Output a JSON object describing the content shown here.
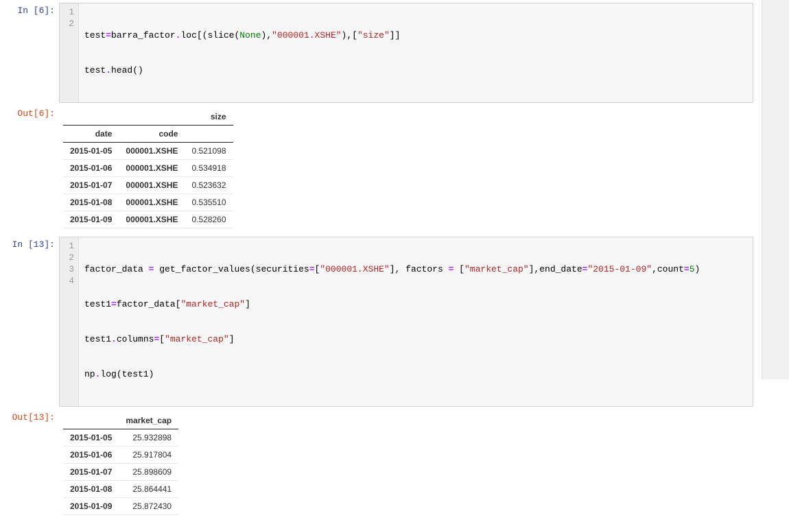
{
  "cells": [
    {
      "in_prompt": "In [6]:",
      "out_prompt": "Out[6]:",
      "code_lines": [
        {
          "n": "1",
          "text": "test=barra_factor.loc[(slice(None),\"000001.XSHE\"),[\"size\"]]"
        },
        {
          "n": "2",
          "text": "test.head()"
        }
      ],
      "table": {
        "col_header": "size",
        "idx_headers": [
          "date",
          "code"
        ],
        "rows": [
          {
            "date": "2015-01-05",
            "code": "000001.XSHE",
            "val": "0.521098"
          },
          {
            "date": "2015-01-06",
            "code": "000001.XSHE",
            "val": "0.534918"
          },
          {
            "date": "2015-01-07",
            "code": "000001.XSHE",
            "val": "0.523632"
          },
          {
            "date": "2015-01-08",
            "code": "000001.XSHE",
            "val": "0.535510"
          },
          {
            "date": "2015-01-09",
            "code": "000001.XSHE",
            "val": "0.528260"
          }
        ]
      }
    },
    {
      "in_prompt": "In [13]:",
      "out_prompt": "Out[13]:",
      "code_lines": [
        {
          "n": "1",
          "text": "factor_data = get_factor_values(securities=[\"000001.XSHE\"], factors = [\"market_cap\"],end_date=\"2015-01-09\",count=5)"
        },
        {
          "n": "2",
          "text": "test1=factor_data[\"market_cap\"]"
        },
        {
          "n": "3",
          "text": "test1.columns=[\"market_cap\"]"
        },
        {
          "n": "4",
          "text": "np.log(test1)"
        }
      ],
      "table": {
        "col_header": "market_cap",
        "idx_headers": [],
        "rows": [
          {
            "date": "2015-01-05",
            "val": "25.932898"
          },
          {
            "date": "2015-01-06",
            "val": "25.917804"
          },
          {
            "date": "2015-01-07",
            "val": "25.898609"
          },
          {
            "date": "2015-01-08",
            "val": "25.864441"
          },
          {
            "date": "2015-01-09",
            "val": "25.872430"
          }
        ]
      }
    }
  ]
}
